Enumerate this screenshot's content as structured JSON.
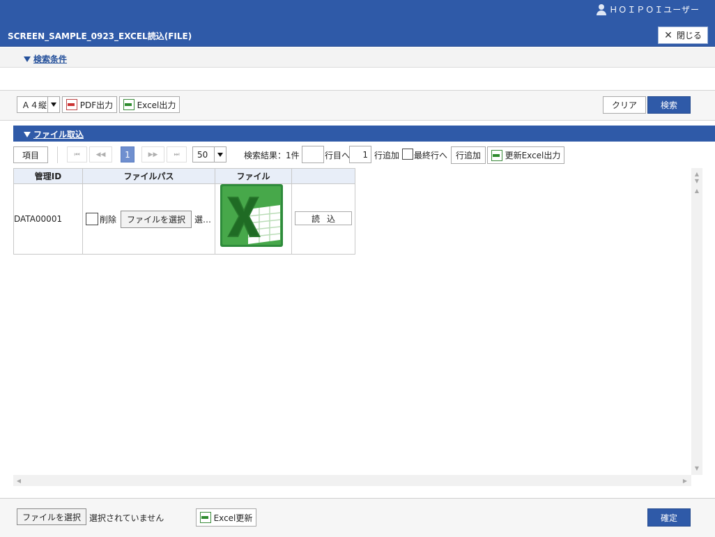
{
  "header": {
    "user_name": "ＨＯＩＰＯＩユーザー",
    "screen_title": "SCREEN_SAMPLE_0923_EXCEL読込(FILE)",
    "close_label": "閉じる"
  },
  "search_conditions": {
    "toggle_label": "検索条件"
  },
  "toolbar": {
    "paper_select_value": "Ａ４縦",
    "pdf_label": "PDF出力",
    "excel_label": "Excel出力",
    "clear_label": "クリア",
    "search_label": "検索"
  },
  "file_section": {
    "toggle_label": "ファイル取込",
    "items_button": "項目",
    "pager": {
      "first": "⏮",
      "prev": "◀◀",
      "current_page": "1",
      "next": "▶▶",
      "last": "⏭",
      "page_size": "50"
    },
    "result_label": "検索結果：1件",
    "goto_row_value": "",
    "goto_row_label": "行目へ",
    "add_count_value": "1",
    "add_row_label": "行追加",
    "last_row_label": "最終行へ",
    "add_row_button": "行追加",
    "update_excel_button": "更新Excel出力"
  },
  "grid": {
    "columns": [
      "管理ID",
      "ファイルパス",
      "ファイル",
      ""
    ],
    "rows": [
      {
        "id": "DATA00001",
        "delete_label": "削除",
        "choose_file": "ファイルを選択",
        "selected_text": "選…",
        "read_button": "読込"
      }
    ]
  },
  "footer": {
    "choose_file": "ファイルを選択",
    "no_file_text": "選択されていません",
    "excel_update": "Excel更新",
    "confirm": "確定"
  },
  "colors": {
    "brand": "#2f5aa8",
    "header_cell": "#e8eef8"
  }
}
